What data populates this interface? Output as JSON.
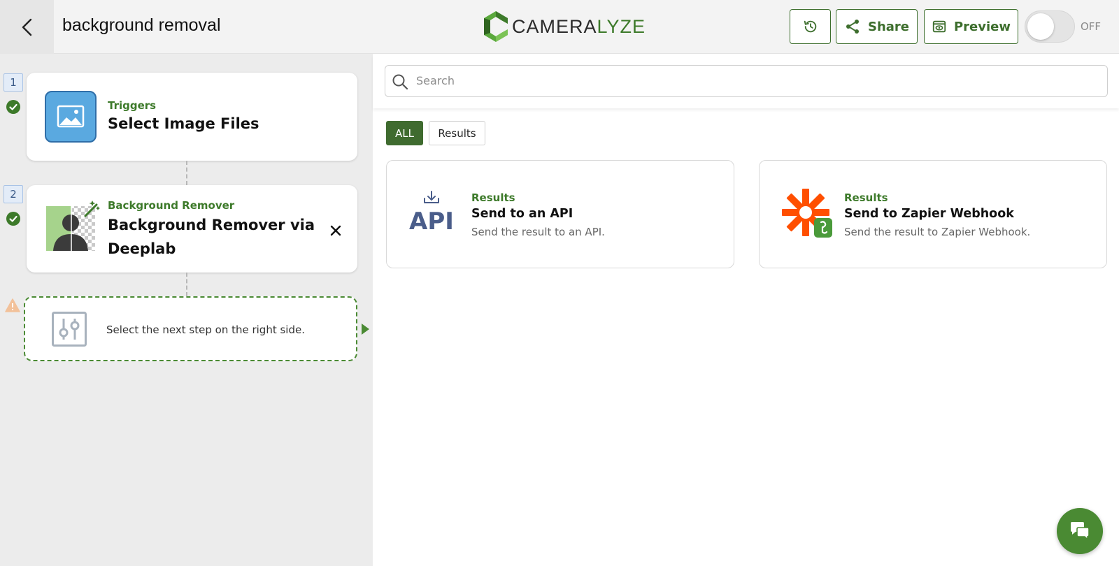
{
  "header": {
    "title": "background removal",
    "logo_prefix": "CAMERA",
    "logo_suffix": "LYZE",
    "share_label": "Share",
    "preview_label": "Preview",
    "toggle_state": "OFF"
  },
  "steps": [
    {
      "number": "1",
      "category": "Triggers",
      "title": "Select Image Files",
      "status": "complete"
    },
    {
      "number": "2",
      "category": "Background Remover",
      "title_line1": "Background Remover via",
      "title_line2": "Deeplab",
      "status": "complete"
    }
  ],
  "next_step": {
    "text": "Select the next step on the right side.",
    "status": "warning"
  },
  "search": {
    "placeholder": "Search",
    "value": ""
  },
  "filters": {
    "all_label": "ALL",
    "results_label": "Results",
    "active": "ALL"
  },
  "results": [
    {
      "category": "Results",
      "title": "Send to an API",
      "description": "Send the result to an API.",
      "icon": "api-icon",
      "icon_text": "API"
    },
    {
      "category": "Results",
      "title": "Send to Zapier Webhook",
      "description": "Send the result to Zapier Webhook.",
      "icon": "zapier-webhook-icon"
    }
  ],
  "colors": {
    "brand_green": "#3d7a2a",
    "active_filter": "#3f6b2f",
    "zapier_orange": "#ff4f00",
    "api_blue": "#4a5d8a",
    "trigger_blue": "#5aa9e0"
  }
}
